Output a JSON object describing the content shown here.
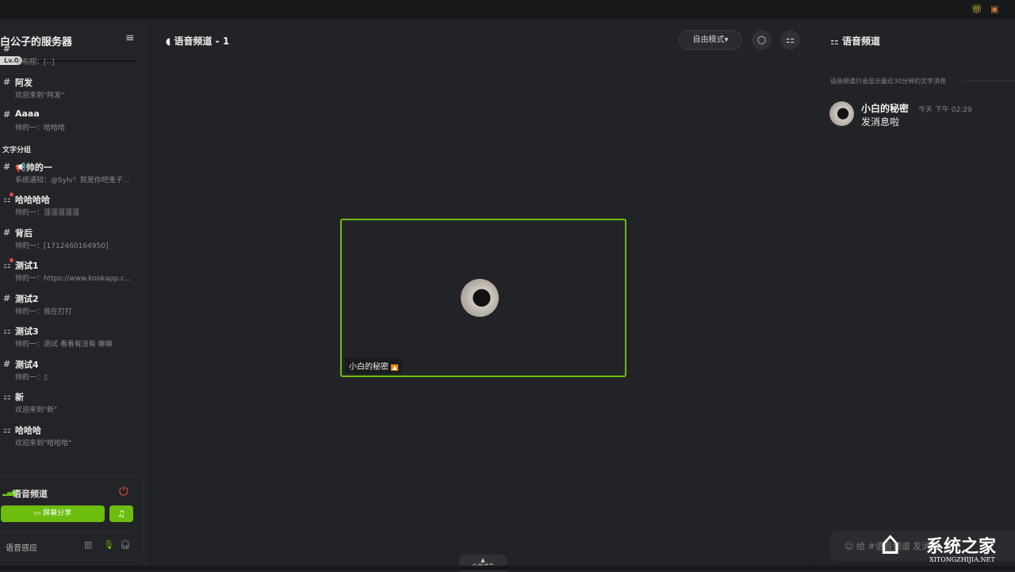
{
  "topbar": {
    "icons": [
      "gift-icon",
      "shop-icon"
    ]
  },
  "sidebar": {
    "server_name": "白公子的服务器",
    "level": "Lv.0",
    "channels": [
      {
        "type": "item",
        "icon": "#",
        "name": "",
        "sub": "布布翔：[--]"
      },
      {
        "type": "item",
        "icon": "#",
        "name": "阿发",
        "sub": "欢迎来到\"阿发\""
      },
      {
        "type": "item",
        "icon": "#",
        "name": "Aaaa",
        "sub": "帅的一：哈哈哈"
      },
      {
        "type": "group",
        "name": "文字分组"
      },
      {
        "type": "item",
        "icon": "#",
        "name": "📢帅的一",
        "sub": "系统通知：@Sylv！就是你吧鬼子..."
      },
      {
        "type": "item",
        "icon": "⚏",
        "dot": true,
        "name": "哈哈哈哈",
        "sub": "帅的一：涯涯涯涯涯"
      },
      {
        "type": "item",
        "icon": "#",
        "name": "背后",
        "sub": "帅的一：[1712460164950]"
      },
      {
        "type": "item",
        "icon": "⚏",
        "dot": true,
        "name": "测试1",
        "sub": "帅的一：https://www.kookapp.c..."
      },
      {
        "type": "item",
        "icon": "#",
        "name": "测试2",
        "sub": "帅的一：我在打打"
      },
      {
        "type": "item",
        "icon": "⚏",
        "name": "测试3",
        "sub": "帅的一：测试 看看有没有 嘛嘛"
      },
      {
        "type": "item",
        "icon": "#",
        "name": "测试4",
        "sub": "帅的一：▯"
      },
      {
        "type": "item",
        "icon": "⚏",
        "name": "新",
        "sub": "欢迎来到\"新\""
      },
      {
        "type": "item",
        "icon": "⚏",
        "name": "哈哈哈",
        "sub": "欢迎来到\"哈哈哈\""
      }
    ],
    "voice": {
      "title": "语音频道",
      "share_label": "屏幕分享",
      "sense_label": "语音感应"
    }
  },
  "main": {
    "title": "语音频道 - 1",
    "mode": "自由模式",
    "tile_user": "小白的秘密",
    "members_label": "全部成员"
  },
  "right": {
    "title": "语音频道",
    "notice": "语音频道只会显示最近30分钟的文字消息",
    "messages": [
      {
        "user": "小白的秘密",
        "time": "今天 下午 02:29",
        "text": "发消息啦"
      }
    ],
    "input_placeholder": "给 #语音频道 发消息"
  },
  "watermark": {
    "title": "系统之家",
    "url": "XITONGZHIJIA.NET"
  },
  "colors": {
    "accent": "#6cbd0d",
    "danger": "#e05040"
  }
}
